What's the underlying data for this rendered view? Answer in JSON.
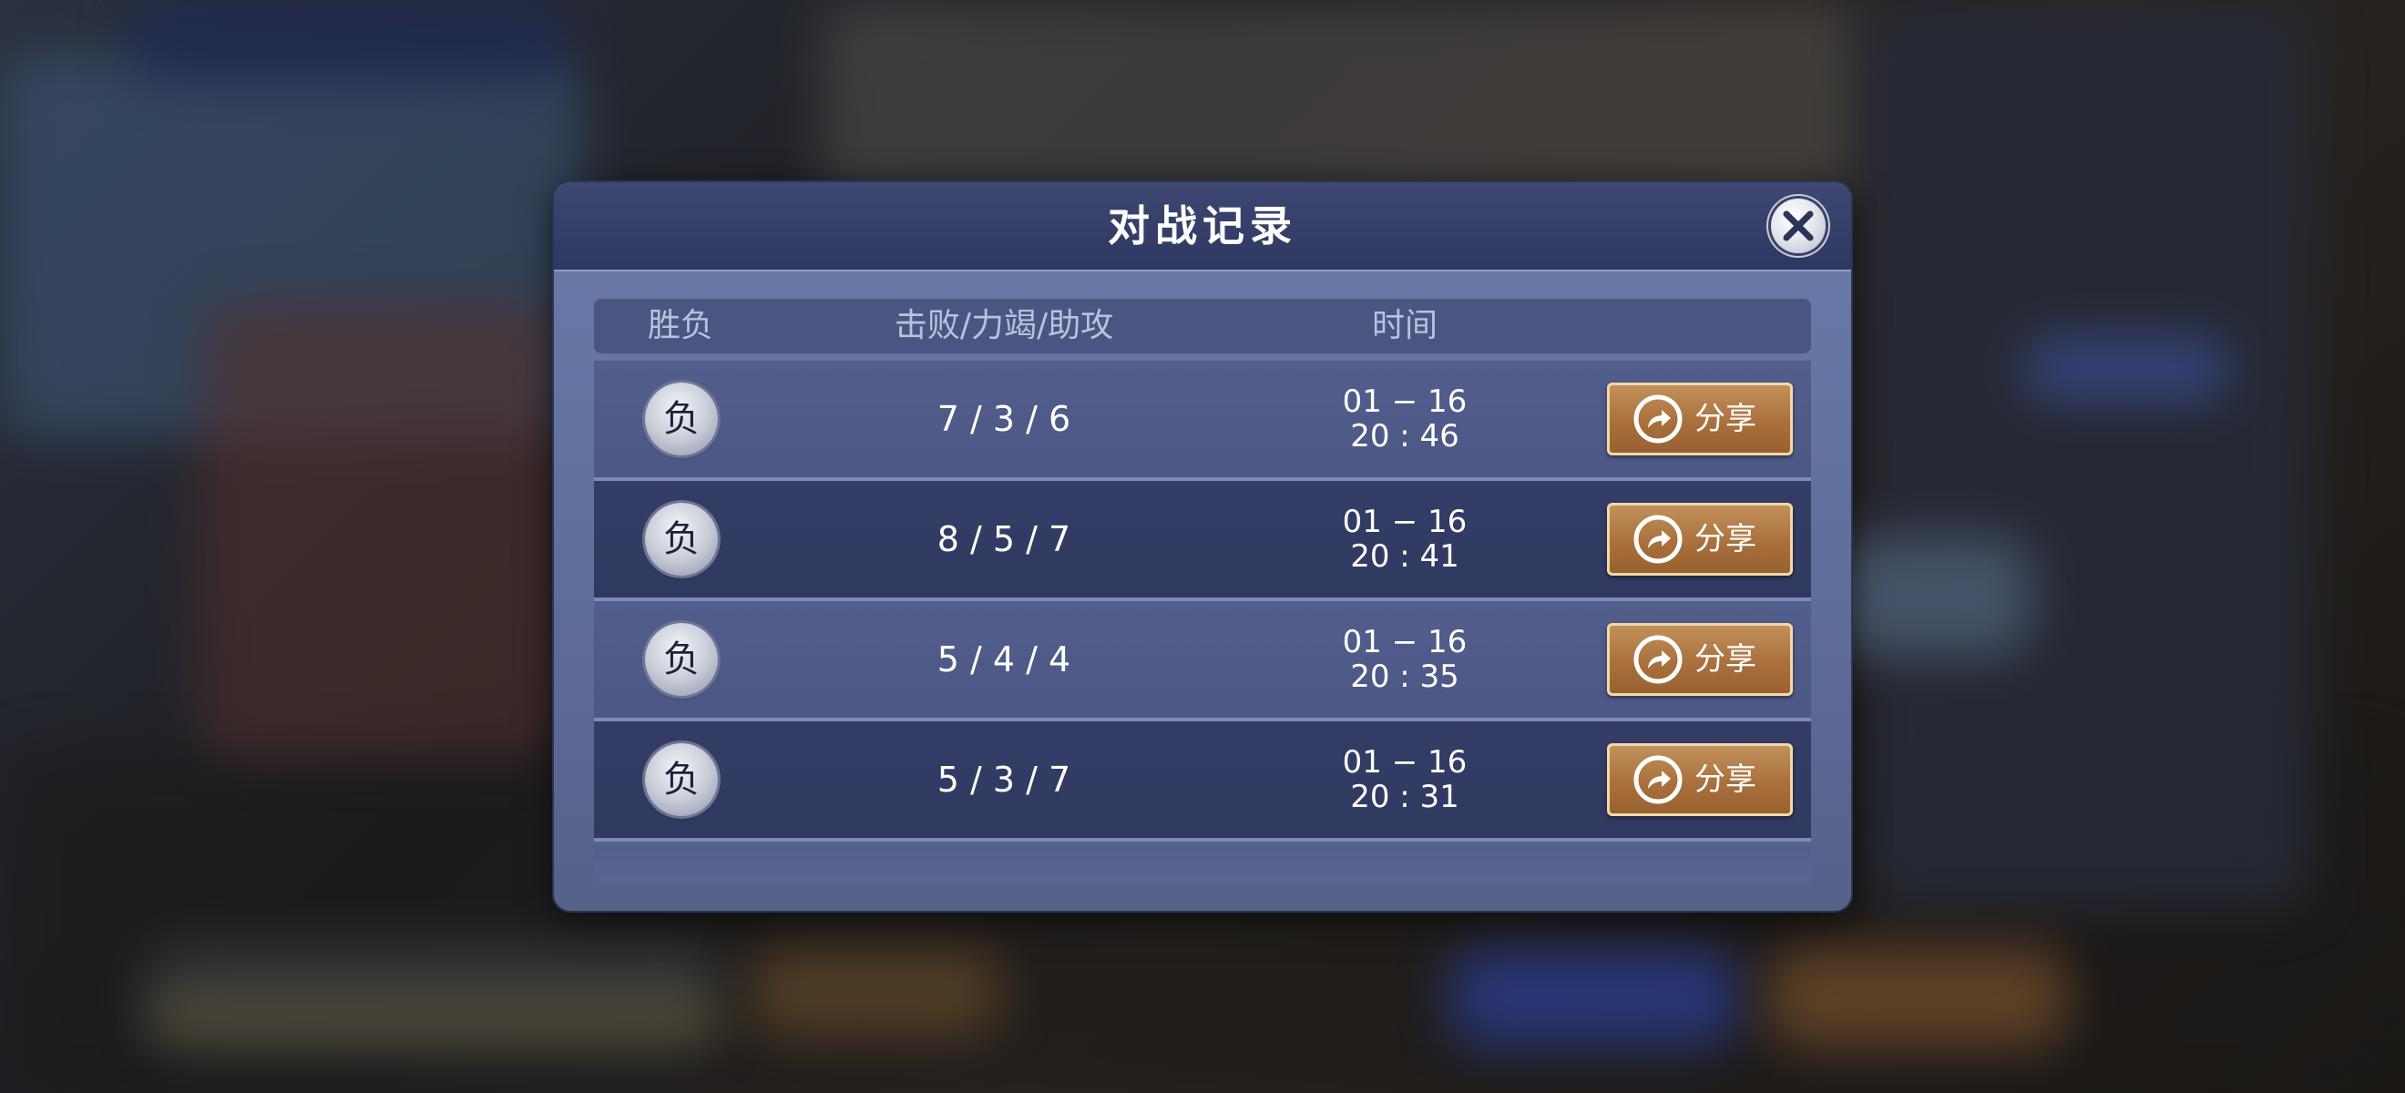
{
  "dialog": {
    "title": "对战记录",
    "close_icon": "close-x-icon"
  },
  "columns": {
    "result": "胜负",
    "kda": "击败/力竭/助攻",
    "time": "时间"
  },
  "records": [
    {
      "result": "负",
      "kda": "7 / 3 / 6",
      "date": "01 − 16",
      "clock": "20 : 46",
      "share_label": "分享"
    },
    {
      "result": "负",
      "kda": "8 / 5 / 7",
      "date": "01 − 16",
      "clock": "20 : 41",
      "share_label": "分享"
    },
    {
      "result": "负",
      "kda": "5 / 4 / 4",
      "date": "01 − 16",
      "clock": "20 : 35",
      "share_label": "分享"
    },
    {
      "result": "负",
      "kda": "5 / 3 / 7",
      "date": "01 − 16",
      "clock": "20 : 31",
      "share_label": "分享"
    }
  ],
  "icons": {
    "share": "share-arrow-icon"
  },
  "colors": {
    "header_bg": "#2e3760",
    "panel_bg": "#5e6c98",
    "share_button": "#a9703d"
  }
}
